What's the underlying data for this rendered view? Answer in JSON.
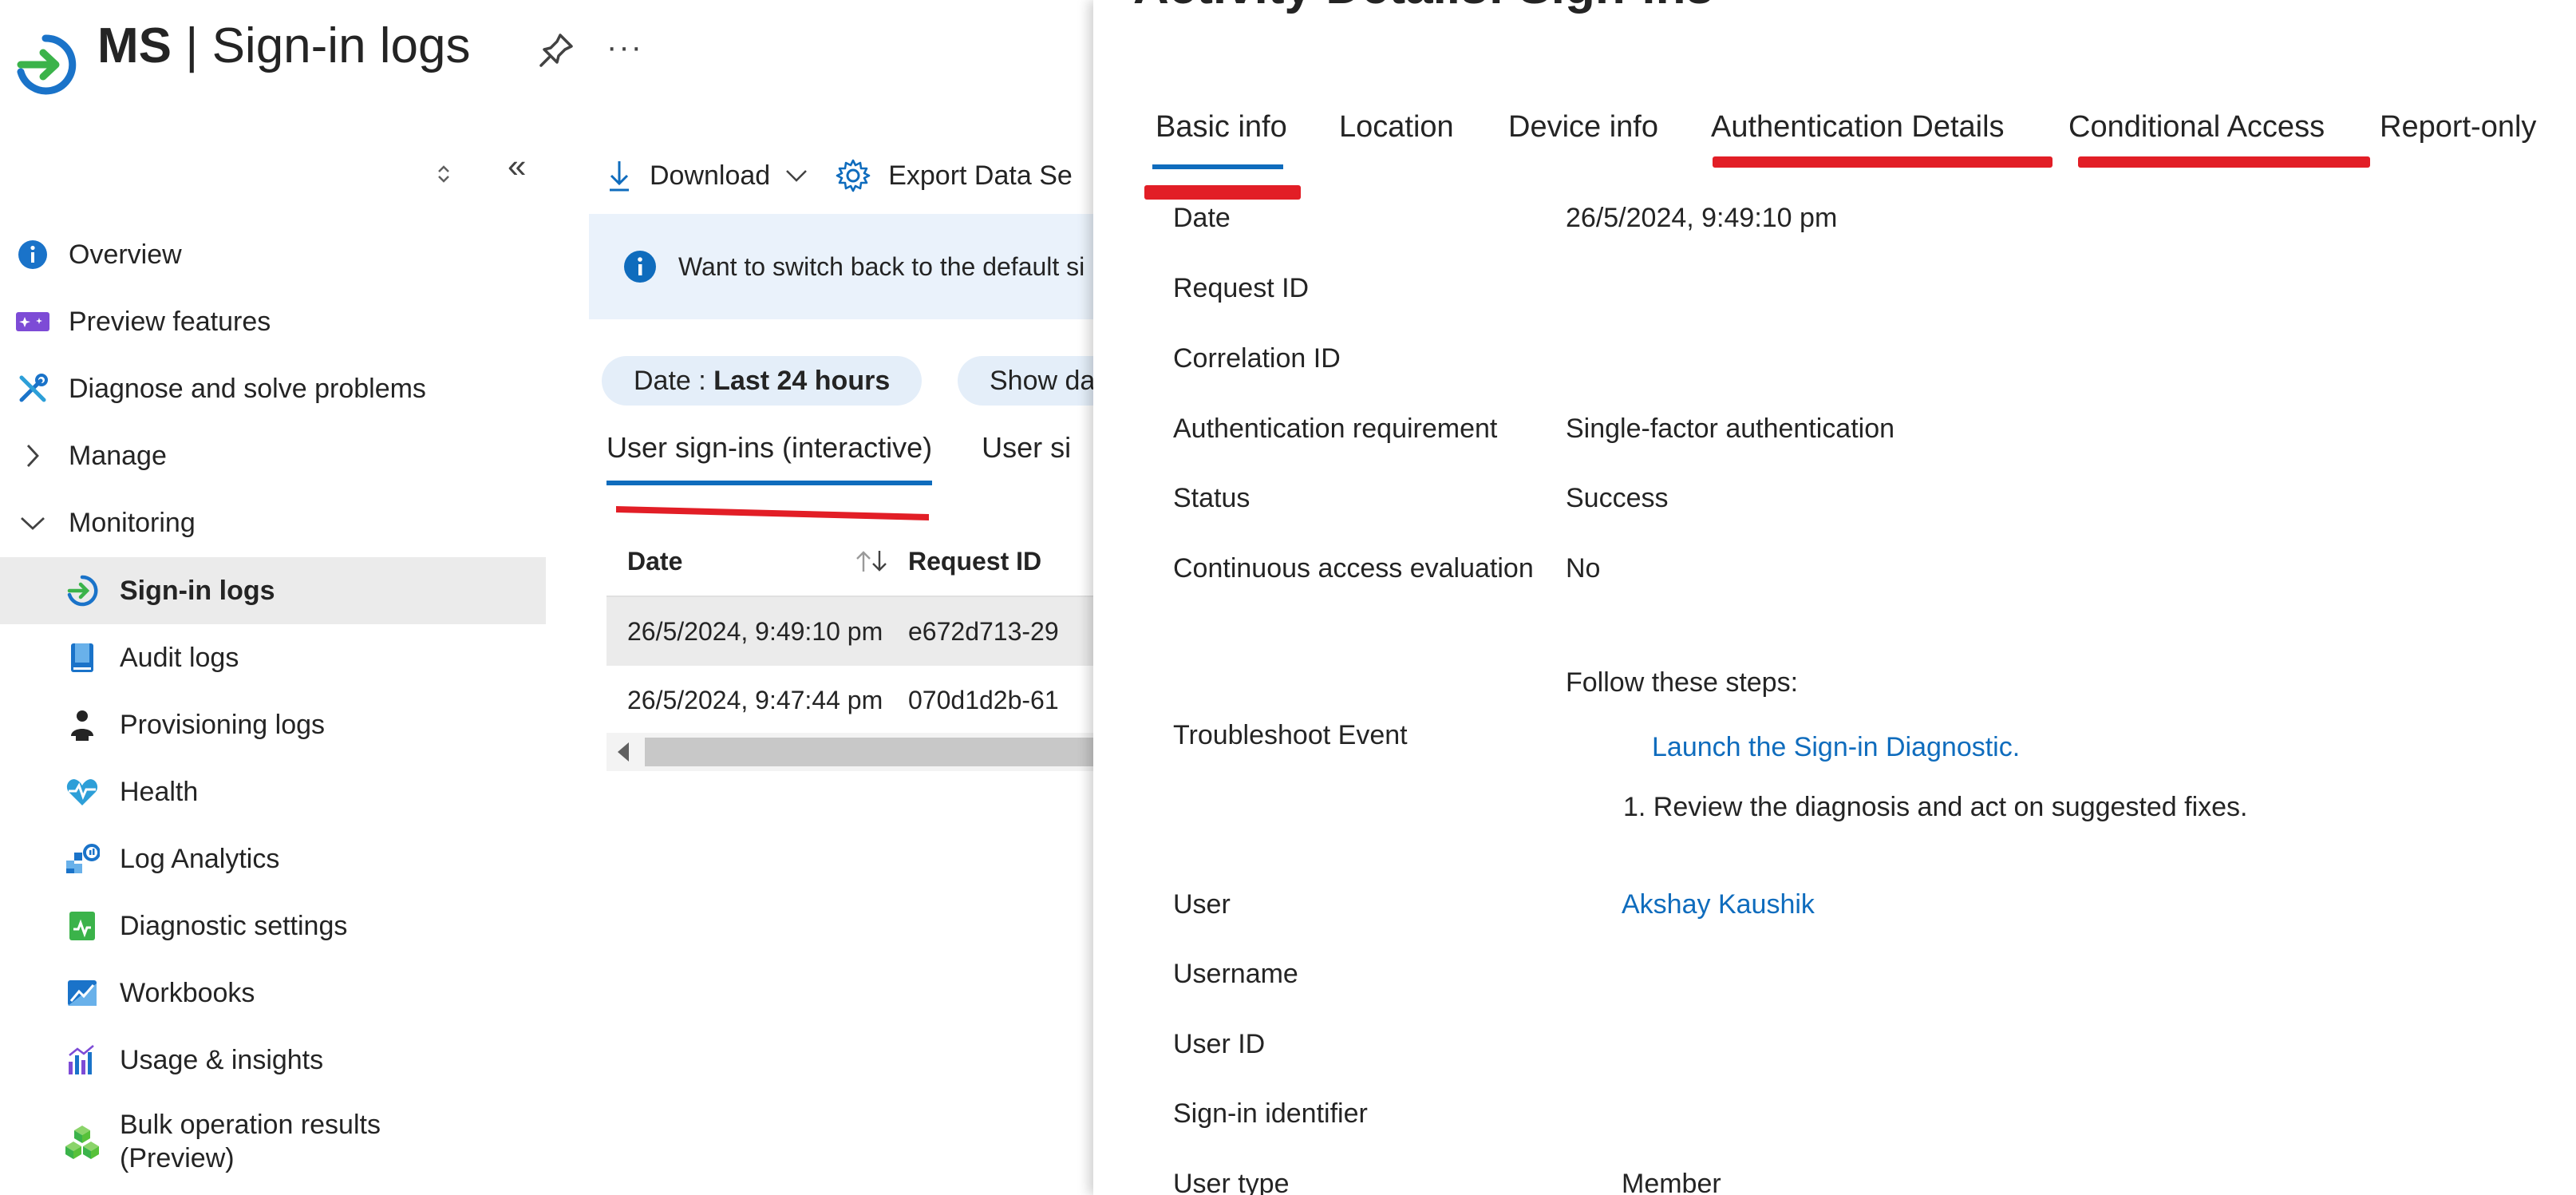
{
  "header": {
    "title_bold": "MS",
    "title_sep": " | ",
    "title_rest": "Sign-in logs",
    "more": "···"
  },
  "sidebar": {
    "items": [
      {
        "label": "Overview",
        "icon": "info-icon"
      },
      {
        "label": "Preview features",
        "icon": "preview-icon"
      },
      {
        "label": "Diagnose and solve problems",
        "icon": "wrench-icon"
      },
      {
        "label": "Manage",
        "icon": "chevron-right-icon"
      },
      {
        "label": "Monitoring",
        "icon": "chevron-down-icon"
      },
      {
        "label": "Sign-in logs",
        "icon": "signin-icon",
        "selected": true
      },
      {
        "label": "Audit logs",
        "icon": "book-icon"
      },
      {
        "label": "Provisioning logs",
        "icon": "person-icon"
      },
      {
        "label": "Health",
        "icon": "heart-icon"
      },
      {
        "label": "Log Analytics",
        "icon": "analytics-icon"
      },
      {
        "label": "Diagnostic settings",
        "icon": "diagnostic-icon"
      },
      {
        "label": "Workbooks",
        "icon": "workbook-icon"
      },
      {
        "label": "Usage & insights",
        "icon": "chart-icon"
      },
      {
        "label": "Bulk operation results (Preview)",
        "icon": "cubes-icon"
      }
    ]
  },
  "toolbar": {
    "download": "Download",
    "export": "Export Data Se"
  },
  "info": {
    "text": "Want to switch back to the default si"
  },
  "filters": {
    "date_prefix": "Date : ",
    "date_value": "Last 24 hours",
    "show": "Show da"
  },
  "middle_tabs": [
    "User sign-ins (interactive)",
    "User si"
  ],
  "table": {
    "headers": [
      "Date",
      "Request ID"
    ],
    "rows": [
      [
        "26/5/2024, 9:49:10 pm",
        "e672d713-29"
      ],
      [
        "26/5/2024, 9:47:44 pm",
        "070d1d2b-61"
      ]
    ]
  },
  "panel": {
    "title": "Activity Details: Sign-ins",
    "tabs": [
      "Basic info",
      "Location",
      "Device info",
      "Authentication Details",
      "Conditional Access",
      "Report-only"
    ],
    "fields": {
      "date_label": "Date",
      "date_value": "26/5/2024, 9:49:10 pm",
      "request_label": "Request ID",
      "correlation_label": "Correlation ID",
      "authreq_label": "Authentication requirement",
      "authreq_value": "Single-factor authentication",
      "status_label": "Status",
      "status_value": "Success",
      "cae_label": "Continuous access evaluation",
      "cae_value": "No",
      "troubleshoot_label": "Troubleshoot Event",
      "steps_title": "Follow these steps:",
      "steps_link": "Launch the Sign-in Diagnostic.",
      "steps_item": "1. Review the diagnosis and act on suggested fixes.",
      "user_label": "User",
      "user_value": "Akshay Kaushik",
      "username_label": "Username",
      "userid_label": "User ID",
      "signin_id_label": "Sign-in identifier",
      "usertype_label": "User type",
      "usertype_value": "Member"
    }
  },
  "colors": {
    "accent": "#0f6cbd",
    "annotation_red": "#e21e26",
    "selected_bg": "#ebebeb",
    "info_bg": "#eaf2fb"
  }
}
